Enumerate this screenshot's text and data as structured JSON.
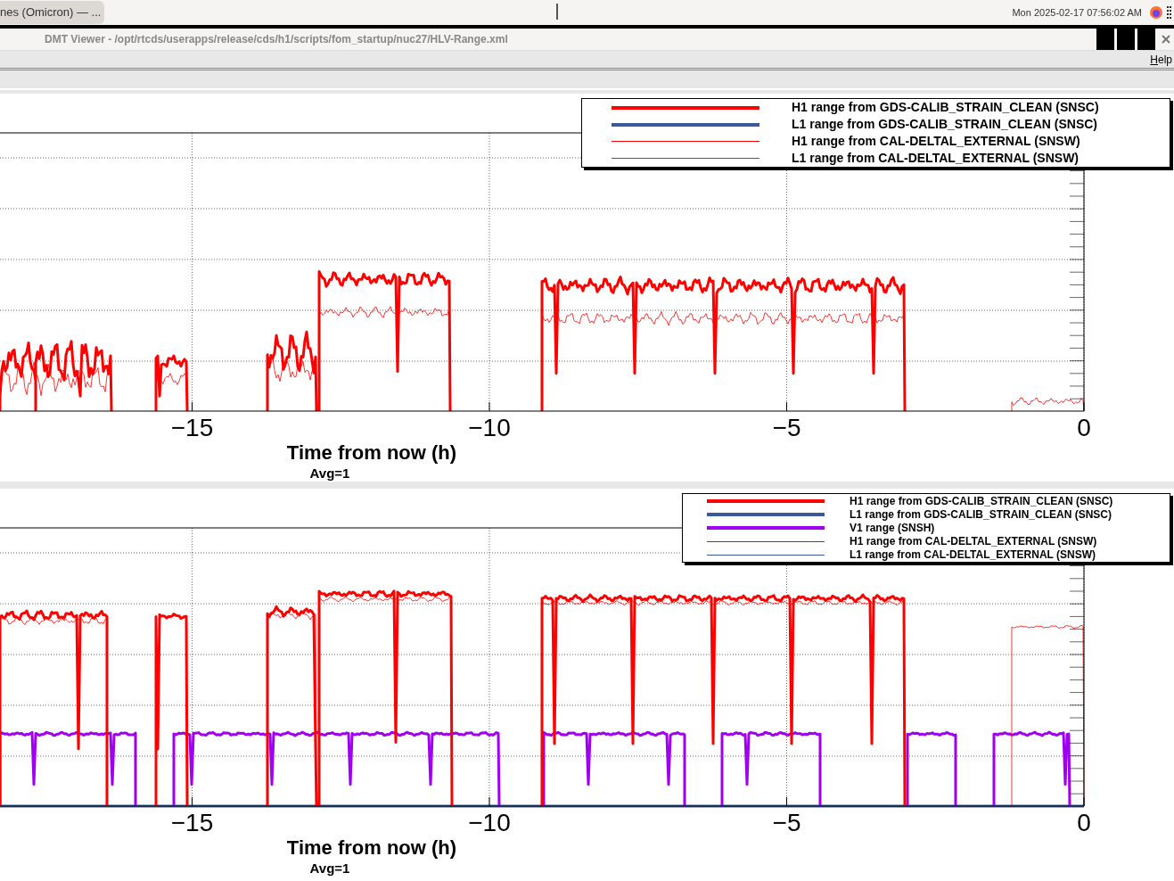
{
  "taskbar": {
    "window_tab": "nes (Omicron) — ...",
    "clock": "Mon 2025-02-17 07:56:02 AM"
  },
  "window": {
    "title": "DMT Viewer - /opt/rtcds/userapps/release/cds/h1/scripts/fom_startup/nuc27/HLV-Range.xml"
  },
  "menu": [
    "Help"
  ],
  "plots": [
    {
      "kind": "range_no_virgo",
      "xticks": [
        "−15",
        "−10",
        "−5",
        "0"
      ],
      "xlabel": "Time from now (h)",
      "note": "Avg=1",
      "legend": [
        {
          "label": "H1 range from GDS-CALIB_STRAIN_CLEAN (SNSC)",
          "color": "#ff0000",
          "kind": "thick"
        },
        {
          "label": "L1 range from GDS-CALIB_STRAIN_CLEAN (SNSC)",
          "color": "#3a5a99",
          "kind": "thick"
        },
        {
          "label": "H1 range from CAL-DELTAL_EXTERNAL (SNSW)",
          "color": "#ff0000",
          "kind": "thin"
        },
        {
          "label": "L1 range from CAL-DELTAL_EXTERNAL (SNSW)",
          "color": "#3a5a99",
          "kind": "thin"
        }
      ]
    },
    {
      "kind": "range_with_virgo",
      "xticks": [
        "−15",
        "−10",
        "−5",
        "0"
      ],
      "xlabel": "Time from now (h)",
      "note": "Avg=1",
      "legend": [
        {
          "label": "H1 range from GDS-CALIB_STRAIN_CLEAN (SNSC)",
          "color": "#ff0000",
          "kind": "thick"
        },
        {
          "label": "L1 range from GDS-CALIB_STRAIN_CLEAN (SNSC)",
          "color": "#3a5a99",
          "kind": "thick"
        },
        {
          "label": "V1 range (SNSH)",
          "color": "#a000f0",
          "kind": "thick"
        },
        {
          "label": "H1 range from CAL-DELTAL_EXTERNAL (SNSW)",
          "color": "#ff0000",
          "kind": "thin"
        },
        {
          "label": "L1 range from CAL-DELTAL_EXTERNAL (SNSW)",
          "color": "#3a5a99",
          "kind": "thin"
        }
      ]
    }
  ]
}
